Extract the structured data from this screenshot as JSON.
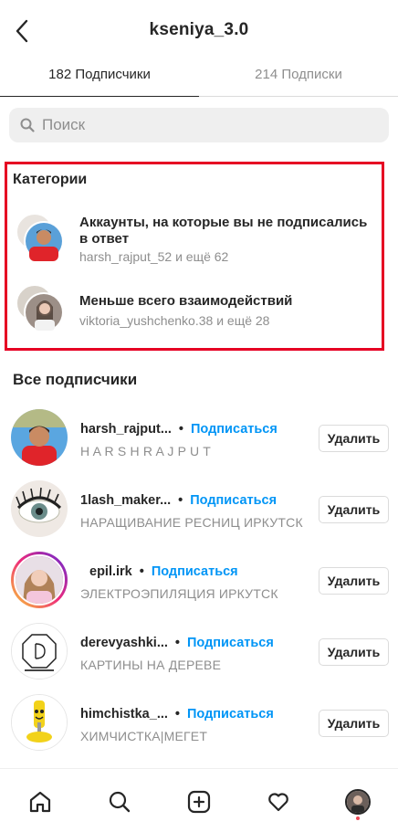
{
  "header": {
    "title": "kseniya_3.0"
  },
  "tabs": [
    {
      "label": "182 Подписчики"
    },
    {
      "label": "214 Подписки"
    }
  ],
  "search": {
    "placeholder": "Поиск"
  },
  "categories": {
    "title": "Категории",
    "items": [
      {
        "primary": "Аккаунты, на которые вы не подписались в ответ",
        "secondary": "harsh_rajput_52 и ещё 62"
      },
      {
        "primary": "Меньше всего взаимодействий",
        "secondary": "viktoria_yushchenko.38 и ещё 28"
      }
    ]
  },
  "followers": {
    "title": "Все подписчики",
    "follow_label": "Подписаться",
    "remove_label": "Удалить",
    "dot": "•",
    "items": [
      {
        "username": "harsh_rajput...",
        "subtitle": "H A R S H   R A J P U T"
      },
      {
        "username": "1lash_maker...",
        "subtitle": "НАРАЩИВАНИЕ РЕСНИЦ ИРКУТСК"
      },
      {
        "username": "epil.irk",
        "subtitle": "ЭЛЕКТРОЭПИЛЯЦИЯ ИРКУТСК"
      },
      {
        "username": "derevyashki...",
        "subtitle": "КАРТИНЫ НА ДЕРЕВЕ"
      },
      {
        "username": "himchistka_...",
        "subtitle": "ХИМЧИСТКА|МЕГЕТ"
      }
    ]
  },
  "colors": {
    "follow": "#0095f6",
    "highlight_border": "#e60023"
  }
}
